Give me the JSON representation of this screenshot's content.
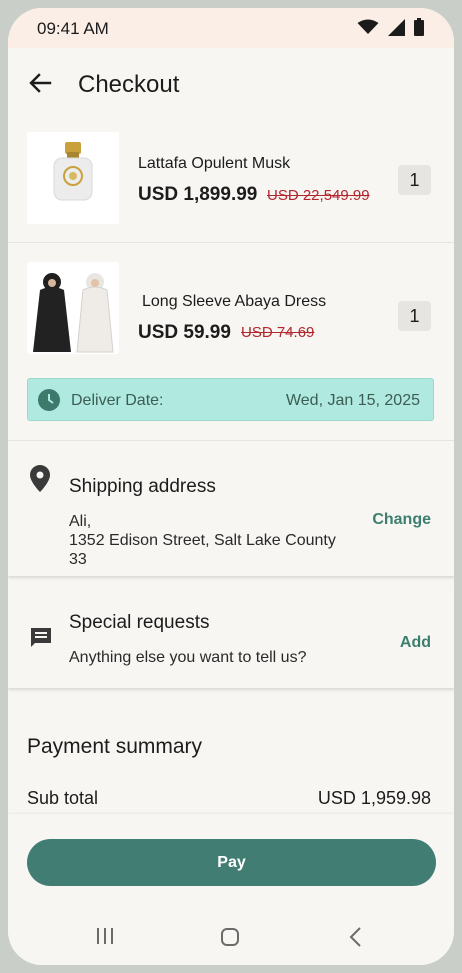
{
  "status": {
    "time": "09:41 AM",
    "icons": [
      "wifi-icon",
      "signal-icon",
      "battery-icon"
    ]
  },
  "header": {
    "title": "Checkout",
    "back_icon": "arrow-left-icon"
  },
  "items": [
    {
      "name": "Lattafa Opulent Musk",
      "price": "USD 1,899.99",
      "old_price": "USD 22,549.99",
      "qty": "1"
    },
    {
      "name": "Long Sleeve Abaya Dress",
      "price": "USD 59.99",
      "old_price": "USD 74.69",
      "qty": "1"
    }
  ],
  "delivery": {
    "label": "Deliver Date:",
    "date": "Wed, Jan 15, 2025",
    "icon": "clock-icon"
  },
  "shipping": {
    "title": "Shipping address",
    "name": "Ali,",
    "address": "1352 Edison Street, Salt Lake County 33",
    "action": "Change",
    "icon": "location-pin-icon"
  },
  "special": {
    "title": "Special requests",
    "subtitle": "Anything else you want to tell us?",
    "action": "Add",
    "icon": "message-icon"
  },
  "summary": {
    "title": "Payment summary",
    "subtotal_label": "Sub total",
    "subtotal_value": "USD 1,959.98"
  },
  "pay_label": "Pay",
  "colors": {
    "accent": "#417d72",
    "delivery_bg": "#afe9df",
    "strike": "#b3262d"
  }
}
